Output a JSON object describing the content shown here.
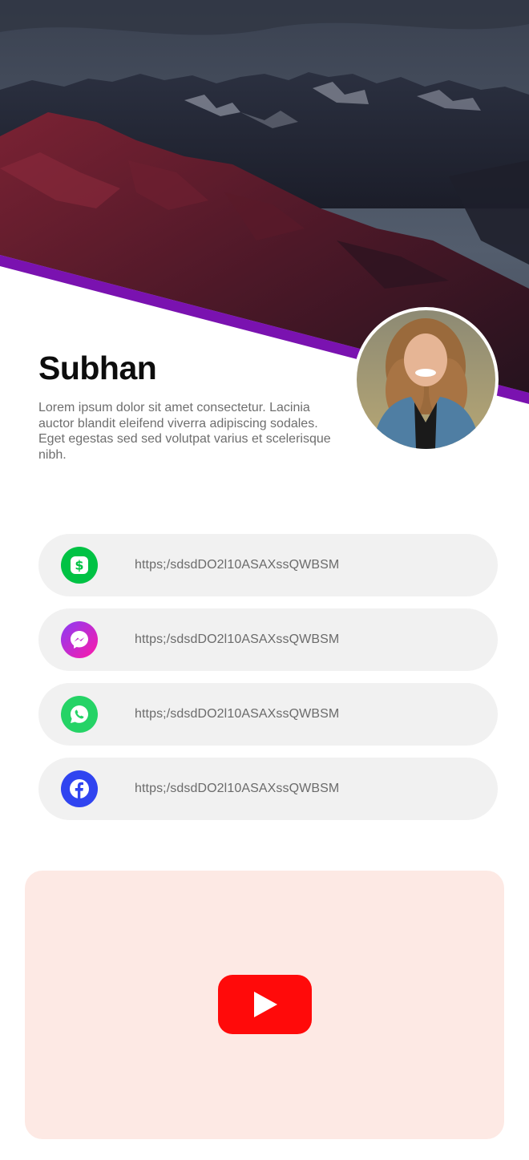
{
  "profile": {
    "name": "Subhan",
    "bio": "Lorem ipsum dolor sit amet consectetur. Lacinia auctor blandit eleifend viverra adipiscing sodales. Eget egestas sed sed volutpat varius et scelerisque nibh."
  },
  "links": [
    {
      "icon": "cash-app-icon",
      "url": "https;/sdsdDO2l10ASAXssQWBSM",
      "color": "#00c244"
    },
    {
      "icon": "messenger-icon",
      "url": "https;/sdsdDO2l10ASAXssQWBSM",
      "color": "#a034ee"
    },
    {
      "icon": "whatsapp-icon",
      "url": "https;/sdsdDO2l10ASAXssQWBSM",
      "color": "#25d366"
    },
    {
      "icon": "facebook-icon",
      "url": "https;/sdsdDO2l10ASAXssQWBSM",
      "color": "#3044f0"
    }
  ],
  "video": {
    "icon": "youtube-play-icon",
    "color": "#ff0a0a"
  },
  "theme": {
    "accent": "#7a12b0",
    "card_bg": "#f1f1f1",
    "video_bg": "#fde9e4"
  }
}
